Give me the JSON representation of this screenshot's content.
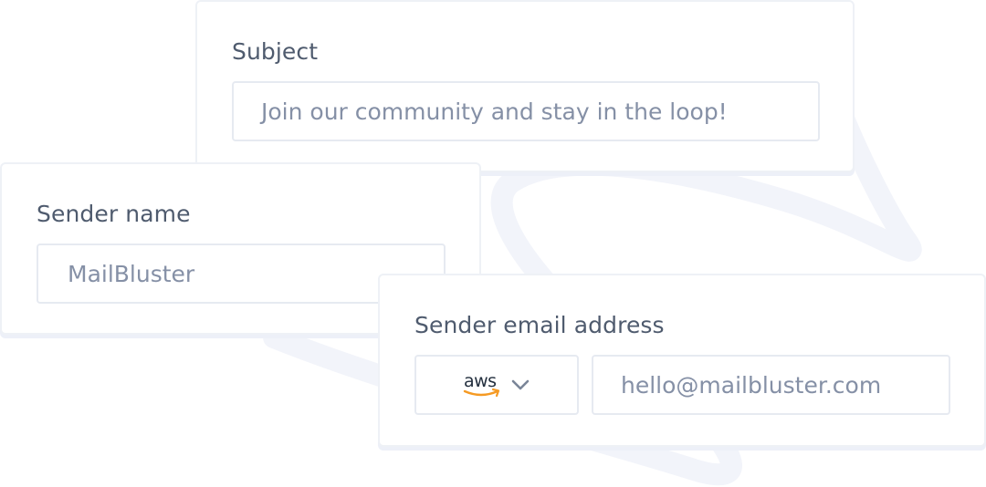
{
  "subject": {
    "label": "Subject",
    "value": "Join our community and stay in the loop!"
  },
  "sender_name": {
    "label": "Sender name",
    "value": "MailBluster"
  },
  "sender_email": {
    "label": "Sender email address",
    "provider": {
      "logo_text": "aws",
      "icon": "aws-logo",
      "dropdown_icon": "chevron-down-icon"
    },
    "value": "hello@mailbluster.com"
  },
  "colors": {
    "label": "#4f5b6e",
    "field_text": "#8590a6",
    "card_border": "#eef1f6",
    "aws_orange": "#f59a23",
    "background_loop": "#f2f4fa"
  }
}
